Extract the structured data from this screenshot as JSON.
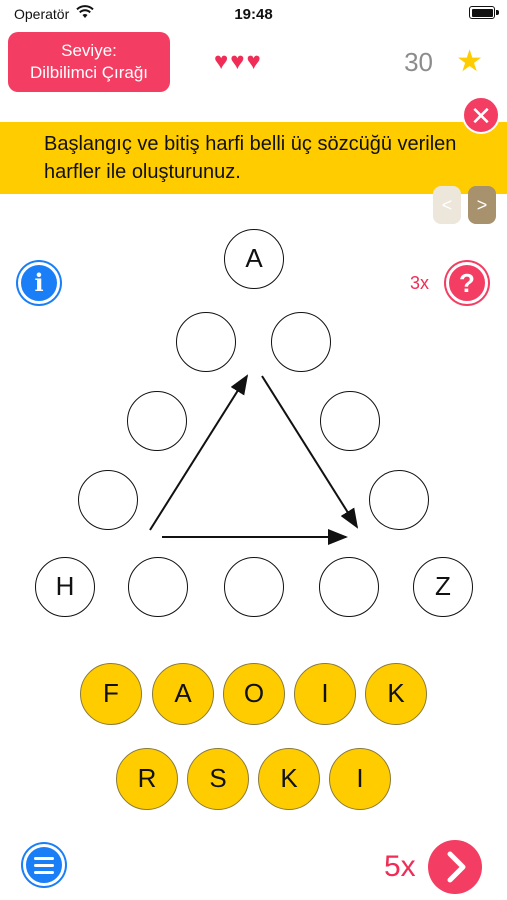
{
  "status_bar": {
    "carrier": "Operatör",
    "time": "19:48"
  },
  "header": {
    "level_label": "Seviye:",
    "level_name": "Dilbilimci Çırağı",
    "hearts": "♥♥♥",
    "score": "30"
  },
  "banner": {
    "text": "Başlangıç ve bitiş harfi belli üç sözcüğü verilen harfler ile oluşturunuz.",
    "close_symbol": "✕",
    "prev_symbol": "<",
    "next_symbol": ">"
  },
  "controls": {
    "info_symbol": "i",
    "hint_count": "3x",
    "help_symbol": "?",
    "skip_count": "5x"
  },
  "puzzle": {
    "top_letter": "A",
    "left_letter": "H",
    "right_letter": "Z"
  },
  "tiles": {
    "row1": [
      "F",
      "A",
      "O",
      "I",
      "K"
    ],
    "row2": [
      "R",
      "S",
      "K",
      "I"
    ]
  },
  "colors": {
    "accent_pink": "#f33d62",
    "banner_yellow": "#ffcc00",
    "info_blue": "#1a7ff6"
  },
  "icons": [
    "wifi-icon",
    "battery-icon",
    "heart-icon",
    "star-icon",
    "close-icon",
    "info-icon",
    "help-icon",
    "menu-icon",
    "chevron-right-icon"
  ]
}
